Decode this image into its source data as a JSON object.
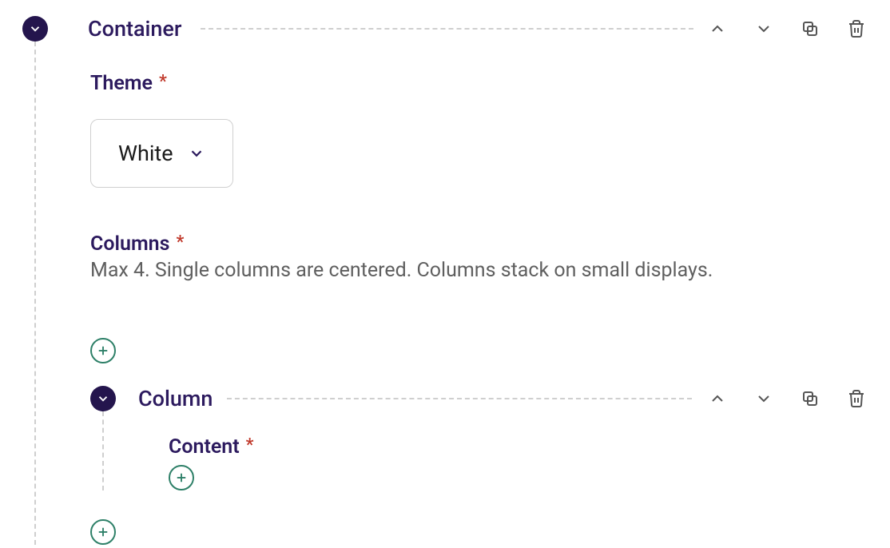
{
  "container": {
    "title": "Container",
    "theme": {
      "label": "Theme",
      "selected": "White"
    },
    "columns": {
      "label": "Columns",
      "help": "Max 4. Single columns are centered. Columns stack on small displays."
    },
    "column": {
      "title": "Column",
      "content_label": "Content"
    }
  }
}
